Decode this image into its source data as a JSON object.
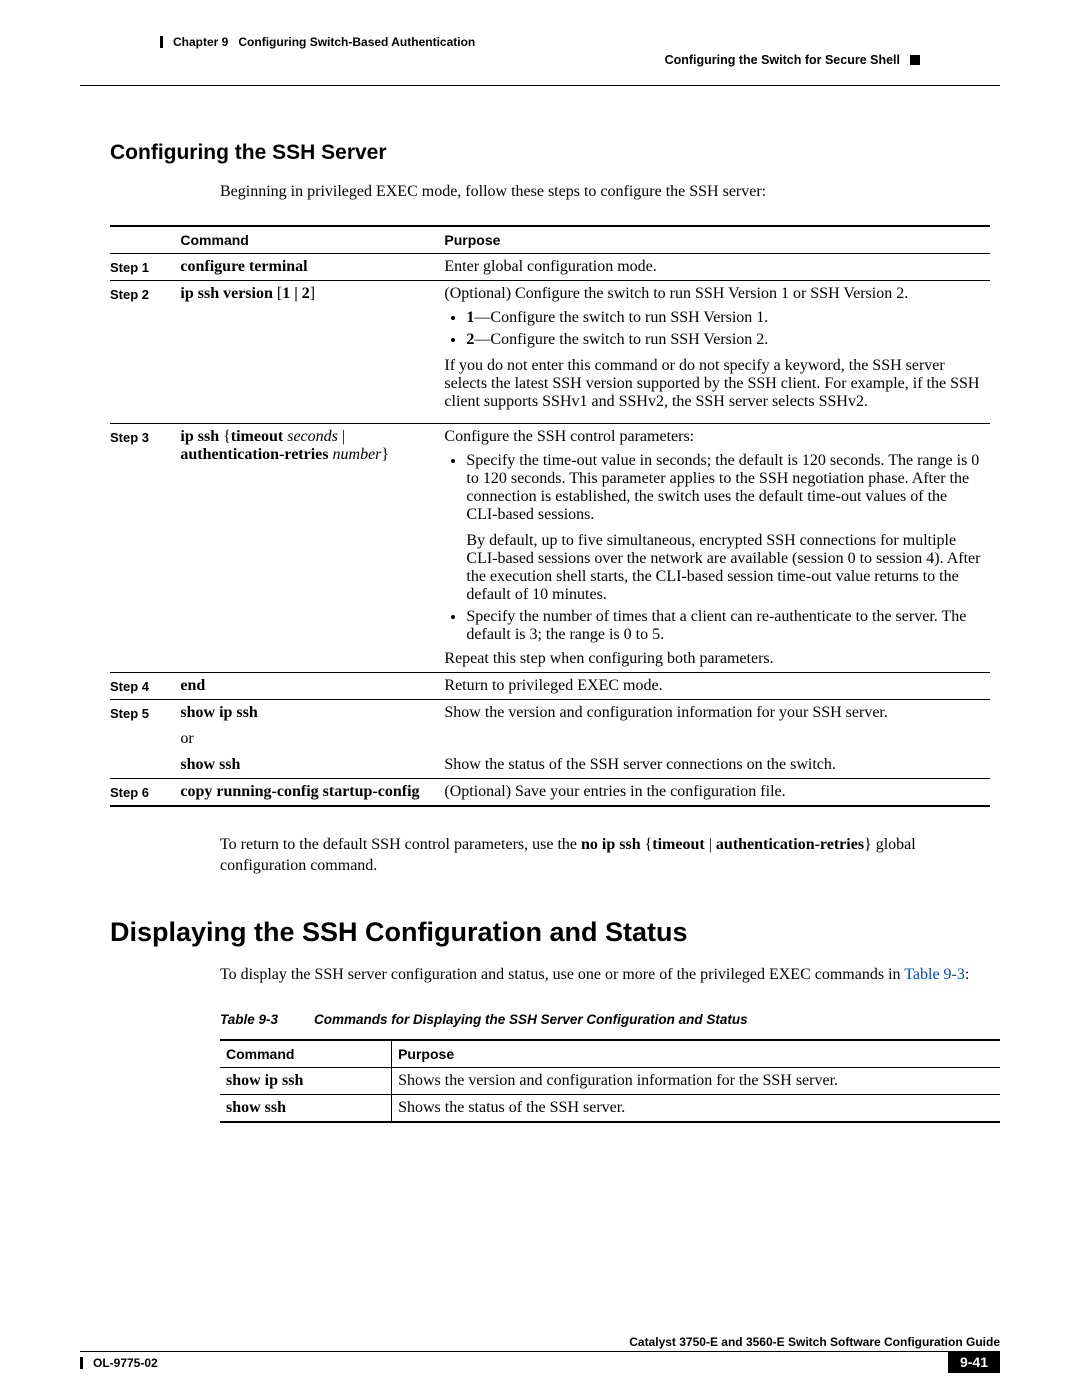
{
  "header": {
    "chapter": "Chapter 9",
    "chapter_title": "Configuring Switch-Based Authentication",
    "section_right": "Configuring the Switch for Secure Shell"
  },
  "section1": {
    "title": "Configuring the SSH Server",
    "intro": "Beginning in privileged EXEC mode, follow these steps to configure the SSH server:"
  },
  "table1": {
    "headers": {
      "command": "Command",
      "purpose": "Purpose"
    },
    "rows": [
      {
        "step": "Step 1",
        "cmd_bold": "configure terminal",
        "purpose": "Enter global configuration mode."
      },
      {
        "step": "Step 2",
        "cmd_bold": "ip ssh version",
        "cmd_bracket_open": " [",
        "cmd_bold_2": "1 | 2",
        "cmd_bracket_close": "]",
        "p_intro": "(Optional) Configure the switch to run SSH Version 1 or SSH Version 2.",
        "b1_bold": "1",
        "b1_text": "—Configure the switch to run SSH Version 1.",
        "b2_bold": "2",
        "b2_text": "—Configure the switch to run SSH Version 2.",
        "p_tail": "If you do not enter this command or do not specify a keyword, the SSH server selects the latest SSH version supported by the SSH client. For example, if the SSH client supports SSHv1 and SSHv2, the SSH server selects SSHv2."
      },
      {
        "step": "Step 3",
        "cmd_line_html": "ip ssh {timeout <span class='arg'>seconds</span> | authentication-retries <span class='arg'>number</span>}",
        "cmd_b1": "ip ssh",
        "cmd_open": " {",
        "cmd_b2": "timeout",
        "cmd_arg1": " seconds",
        "cmd_sep": " | ",
        "cmd_b3": "authentication-retries",
        "cmd_arg2": " number",
        "cmd_close": "}",
        "p_intro": "Configure the SSH control parameters:",
        "b1": "Specify the time-out value in seconds; the default is 120 seconds. The range is 0 to 120 seconds. This parameter applies to the SSH negotiation phase. After the connection is established, the switch uses the default time-out values of the CLI-based sessions.",
        "b1_extra": "By default, up to five simultaneous, encrypted SSH connections for multiple CLI-based sessions over the network are available (session 0 to session 4). After the execution shell starts, the CLI-based session time-out value returns to the default of 10 minutes.",
        "b2": "Specify the number of times that a client can re-authenticate to the server. The default is 3; the range is 0 to 5.",
        "p_tail": "Repeat this step when configuring both parameters."
      },
      {
        "step": "Step 4",
        "cmd_bold": "end",
        "purpose": "Return to privileged EXEC mode."
      },
      {
        "step": "Step 5",
        "cmd_bold_1": "show ip ssh",
        "cmd_or": "or",
        "cmd_bold_2": "show ssh",
        "p1": "Show the version and configuration information for your SSH server.",
        "p2": "Show the status of the SSH server connections on the switch."
      },
      {
        "step": "Step 6",
        "cmd_bold": "copy running-config startup-config",
        "purpose": "(Optional) Save your entries in the configuration file."
      }
    ]
  },
  "post_note": {
    "lead": "To return to the default SSH control parameters, use the ",
    "b1": "no ip ssh",
    "open": " {",
    "b2": "timeout",
    "sep": " | ",
    "b3": "authentication-retries",
    "close": "}",
    "tail": " global configuration command."
  },
  "section2": {
    "title": "Displaying the SSH Configuration and Status",
    "intro_lead": "To display the SSH server configuration and status, use one or more of the privileged EXEC commands in ",
    "intro_ref": "Table 9-3",
    "intro_tail": ":"
  },
  "caption": {
    "num": "Table 9-3",
    "text": "Commands for Displaying the SSH Server Configuration and Status"
  },
  "table2": {
    "headers": {
      "command": "Command",
      "purpose": "Purpose"
    },
    "rows": [
      {
        "cmd": "show ip ssh",
        "purpose": "Shows the version and configuration information for the SSH server."
      },
      {
        "cmd": "show ssh",
        "purpose": "Shows the status of the SSH server."
      }
    ]
  },
  "footer": {
    "manual": "Catalyst 3750-E and 3560-E Switch Software Configuration Guide",
    "docnum": "OL-9775-02",
    "page": "9-41"
  }
}
